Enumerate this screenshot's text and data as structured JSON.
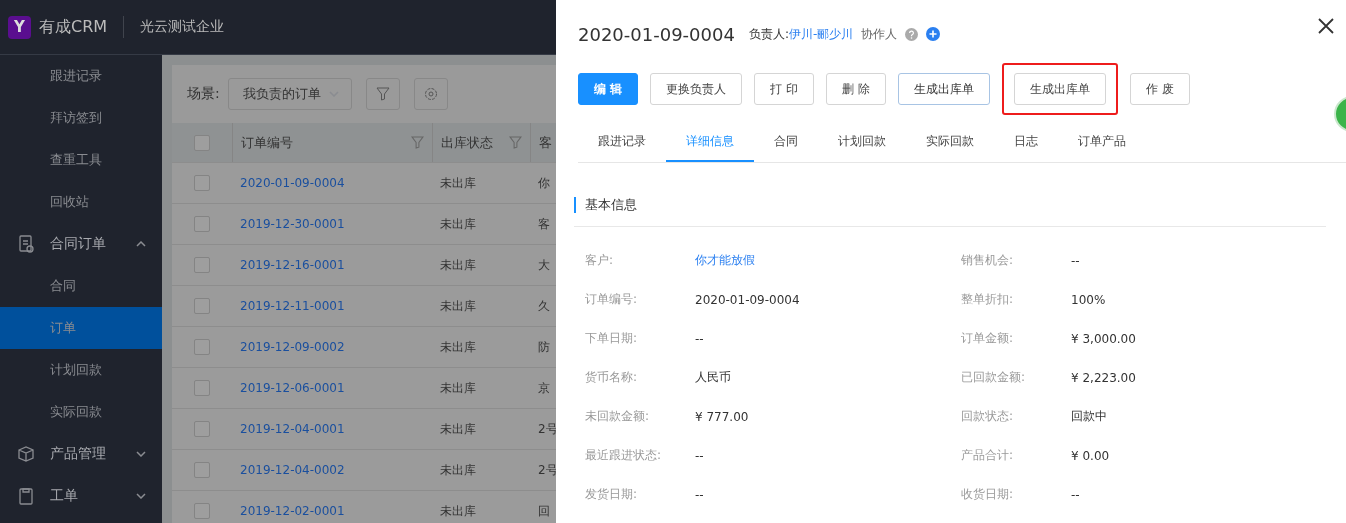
{
  "header": {
    "logo_letter": "Y",
    "app_name": "有成CRM",
    "company": "光云测试企业"
  },
  "sidebar": {
    "items": [
      {
        "label": "跟进记录",
        "kind": "sub",
        "selected": false
      },
      {
        "label": "拜访签到",
        "kind": "sub",
        "selected": false
      },
      {
        "label": "查重工具",
        "kind": "sub",
        "selected": false
      },
      {
        "label": "回收站",
        "kind": "sub",
        "selected": false
      },
      {
        "label": "合同订单",
        "kind": "group",
        "expanded": true,
        "selected": false
      },
      {
        "label": "合同",
        "kind": "sub",
        "selected": false
      },
      {
        "label": "订单",
        "kind": "sub",
        "selected": true
      },
      {
        "label": "计划回款",
        "kind": "sub",
        "selected": false
      },
      {
        "label": "实际回款",
        "kind": "sub",
        "selected": false
      },
      {
        "label": "产品管理",
        "kind": "group",
        "expanded": false,
        "selected": false
      },
      {
        "label": "工单",
        "kind": "group",
        "expanded": false,
        "selected": false
      }
    ]
  },
  "list": {
    "scene_label": "场景:",
    "scene_value": "我负责的订单",
    "header_checked": false,
    "columns": [
      "订单编号",
      "出库状态",
      "客"
    ],
    "rows": [
      {
        "order_no": "2020-01-09-0004",
        "status": "未出库",
        "column_3": "你",
        "checked": false
      },
      {
        "order_no": "2019-12-30-0001",
        "status": "未出库",
        "column_3": "客",
        "checked": false
      },
      {
        "order_no": "2019-12-16-0001",
        "status": "未出库",
        "column_3": "大",
        "checked": false
      },
      {
        "order_no": "2019-12-11-0001",
        "status": "未出库",
        "column_3": "久",
        "checked": false
      },
      {
        "order_no": "2019-12-09-0002",
        "status": "未出库",
        "column_3": "防",
        "checked": false
      },
      {
        "order_no": "2019-12-06-0001",
        "status": "未出库",
        "column_3": "京",
        "checked": false
      },
      {
        "order_no": "2019-12-04-0001",
        "status": "未出库",
        "column_3": "2号",
        "checked": false
      },
      {
        "order_no": "2019-12-04-0002",
        "status": "未出库",
        "column_3": "2号",
        "checked": false
      },
      {
        "order_no": "2019-12-02-0001",
        "status": "未出库",
        "column_3": "回",
        "checked": false
      }
    ]
  },
  "drawer": {
    "title": "2020-01-09-0004",
    "owner_label": "负责人:",
    "owner": "伊川-郦少川",
    "collaborator_label": "协作人",
    "buttons": [
      {
        "label": "编 辑",
        "kind": "primary",
        "highlighted": false
      },
      {
        "label": "更换负责人",
        "kind": "default",
        "highlighted": false
      },
      {
        "label": "打 印",
        "kind": "default",
        "highlighted": false
      },
      {
        "label": "删 除",
        "kind": "default",
        "highlighted": false
      },
      {
        "label": "生成出库单",
        "kind": "hover",
        "highlighted": false
      },
      {
        "label": "生成出库单",
        "kind": "default",
        "highlighted": true
      },
      {
        "label": "作 废",
        "kind": "default",
        "highlighted": false
      }
    ],
    "tabs": [
      {
        "label": "跟进记录",
        "selected": false
      },
      {
        "label": "详细信息",
        "selected": true
      },
      {
        "label": "合同",
        "selected": false
      },
      {
        "label": "计划回款",
        "selected": false
      },
      {
        "label": "实际回款",
        "selected": false
      },
      {
        "label": "日志",
        "selected": false
      },
      {
        "label": "订单产品",
        "selected": false
      }
    ],
    "section_title": "基本信息",
    "fields": [
      {
        "label": "客户:",
        "value": "你才能放假",
        "kind": "link"
      },
      {
        "label": "销售机会:",
        "value": "--",
        "kind": "text"
      },
      {
        "label": "订单编号:",
        "value": "2020-01-09-0004",
        "kind": "text"
      },
      {
        "label": "整单折扣:",
        "value": "100%",
        "kind": "text"
      },
      {
        "label": "下单日期:",
        "value": "--",
        "kind": "text"
      },
      {
        "label": "订单金额:",
        "value": "¥ 3,000.00",
        "kind": "text"
      },
      {
        "label": "货币名称:",
        "value": "人民币",
        "kind": "text"
      },
      {
        "label": "已回款金额:",
        "value": "¥ 2,223.00",
        "kind": "text"
      },
      {
        "label": "未回款金额:",
        "value": "¥ 777.00",
        "kind": "text"
      },
      {
        "label": "回款状态:",
        "value": "回款中",
        "kind": "text"
      },
      {
        "label": "最近跟进状态:",
        "value": "--",
        "kind": "text"
      },
      {
        "label": "产品合计:",
        "value": "¥ 0.00",
        "kind": "text"
      },
      {
        "label": "发货日期:",
        "value": "--",
        "kind": "text"
      },
      {
        "label": "收货日期:",
        "value": "--",
        "kind": "text"
      }
    ]
  }
}
